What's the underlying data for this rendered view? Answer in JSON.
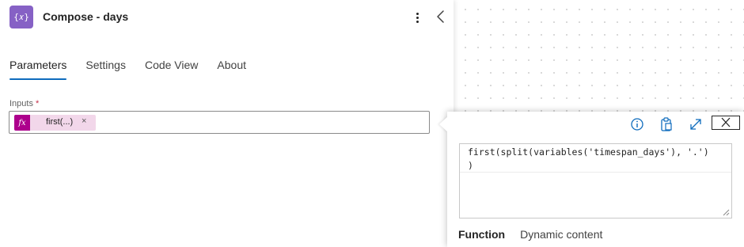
{
  "panel": {
    "title": "Compose - days",
    "icon": "compose-expression-icon",
    "icon_glyph": "{𝑥}",
    "tabs": [
      {
        "label": "Parameters",
        "active": true
      },
      {
        "label": "Settings",
        "active": false
      },
      {
        "label": "Code View",
        "active": false
      },
      {
        "label": "About",
        "active": false
      }
    ],
    "inputs": {
      "label": "Inputs",
      "required_mark": "*",
      "token": {
        "icon_glyph": "fx",
        "text": "first(...)",
        "close": "×"
      }
    }
  },
  "expression_popup": {
    "toolbar": {
      "info_icon": "info-icon",
      "paste_icon": "clipboard-icon",
      "expand_icon": "expand-icon",
      "close_icon": "close-icon"
    },
    "expression_lines": [
      "first(split(variables('timespan_days'), '.')",
      ")"
    ],
    "tabs": [
      {
        "label": "Function",
        "active": true
      },
      {
        "label": "Dynamic content",
        "active": false
      }
    ]
  },
  "colors": {
    "accent": "#0f6cbd",
    "compose_icon_bg": "#8661c5",
    "token_bg": "#f2d7ea",
    "token_icon_bg": "#ad008c",
    "required": "#c4314b"
  }
}
